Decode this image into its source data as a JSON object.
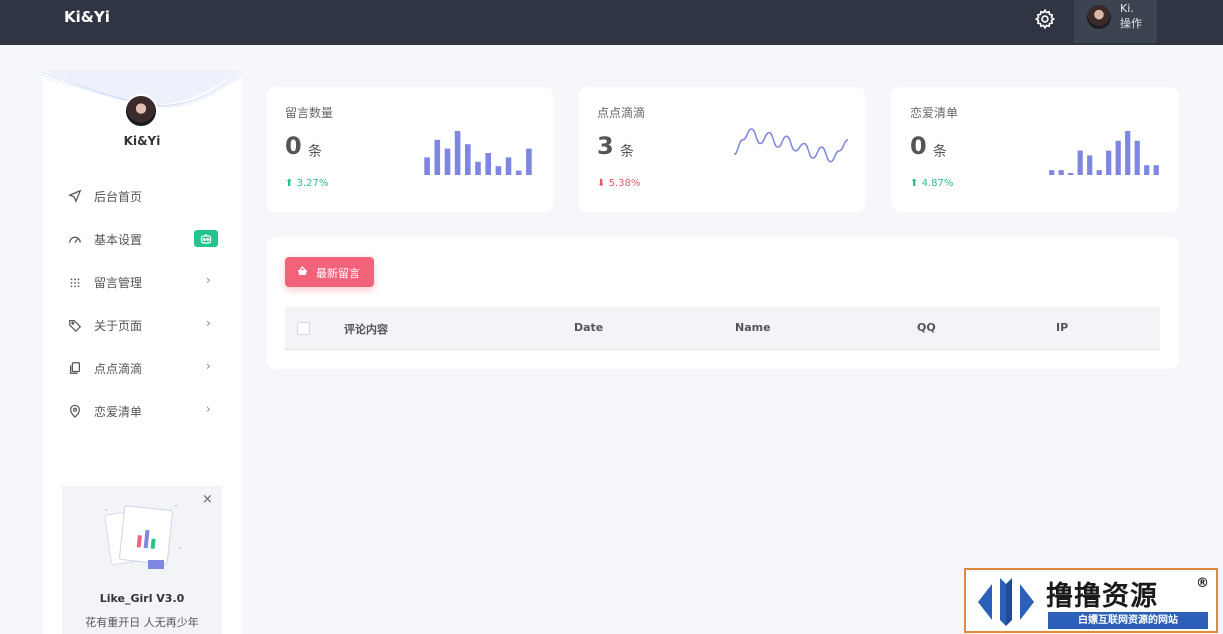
{
  "topbar": {
    "brand": "Ki&Yi",
    "user_name": "Ki.",
    "user_action": "操作"
  },
  "sidebar": {
    "profile_name": "Ki&Yi",
    "items": [
      {
        "label": "后台首页",
        "icon": "navigation-icon",
        "chevron": ""
      },
      {
        "label": "基本设置",
        "icon": "gauge-icon",
        "badge_icon": "robot-icon"
      },
      {
        "label": "留言管理",
        "icon": "grid-icon",
        "chevron": "›"
      },
      {
        "label": "关于页面",
        "icon": "tag-icon",
        "chevron": "›"
      },
      {
        "label": "点点滴滴",
        "icon": "copy-icon",
        "chevron": "›"
      },
      {
        "label": "恋爱清单",
        "icon": "location-pin-icon",
        "chevron": "›"
      }
    ],
    "promo": {
      "close": "×",
      "title": "Like_Girl V3.0",
      "subtitle": "花有重开日 人无再少年"
    }
  },
  "stats": [
    {
      "label": "留言数量",
      "value": "0",
      "unit": "条",
      "trend": "3.27%",
      "direction": "up"
    },
    {
      "label": "点点滴滴",
      "value": "3",
      "unit": "条",
      "trend": "5.38%",
      "direction": "down"
    },
    {
      "label": "恋爱清单",
      "value": "0",
      "unit": "条",
      "trend": "4.87%",
      "direction": "up"
    }
  ],
  "chart_data": [
    {
      "type": "bar",
      "values": [
        4,
        8,
        6,
        10,
        7,
        3,
        5,
        2,
        4,
        1,
        6
      ]
    },
    {
      "type": "line",
      "values": [
        4,
        8,
        11,
        7,
        10,
        6,
        9,
        5,
        7,
        3,
        6,
        2,
        5,
        8
      ]
    },
    {
      "type": "bar",
      "values": [
        1,
        1,
        0,
        5,
        4,
        1,
        5,
        7,
        9,
        7,
        2,
        2
      ]
    }
  ],
  "table": {
    "new_button": "最新留言",
    "headers": [
      "评论内容",
      "Date",
      "Name",
      "QQ",
      "IP"
    ]
  },
  "watermark": {
    "title": "撸撸资源",
    "reg": "®",
    "subtitle": "白嫖互联网资源的网站"
  },
  "colors": {
    "topbar": "#2f3542",
    "accent_bar": "#7f86e0",
    "up": "#2bbf8b",
    "down": "#e25a6a",
    "button": "#f2627b",
    "badge": "#23c48e"
  }
}
